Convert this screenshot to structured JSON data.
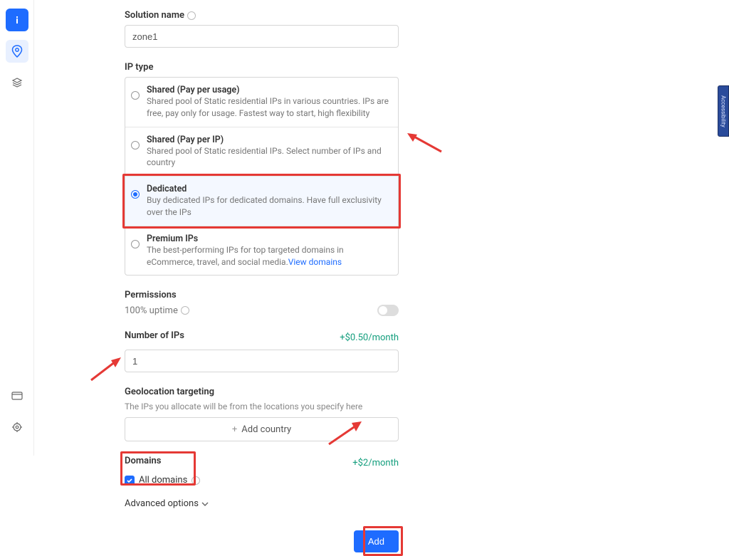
{
  "solution": {
    "label": "Solution name",
    "value": "zone1"
  },
  "ipType": {
    "label": "IP type",
    "options": [
      {
        "title": "Shared (Pay per usage)",
        "desc": "Shared pool of Static residential IPs in various countries. IPs are free, pay only for usage. Fastest way to start, high flexibility",
        "selected": false
      },
      {
        "title": "Shared (Pay per IP)",
        "desc": "Shared pool of Static residential IPs. Select number of IPs and country",
        "selected": false
      },
      {
        "title": "Dedicated",
        "desc": "Buy dedicated IPs for dedicated domains. Have full exclusivity over the IPs",
        "selected": true
      },
      {
        "title": "Premium IPs",
        "desc": "The best-performing IPs for top targeted domains in eCommerce, travel, and social media.",
        "link": "View domains",
        "selected": false
      }
    ]
  },
  "permissions": {
    "label": "Permissions",
    "value": "100% uptime"
  },
  "numIps": {
    "label": "Number of IPs",
    "price": "+$0.50/month",
    "value": "1"
  },
  "geo": {
    "label": "Geolocation targeting",
    "desc": "The IPs you allocate will be from the locations you specify here",
    "addCountry": "Add country"
  },
  "domains": {
    "label": "Domains",
    "price": "+$2/month",
    "checkboxLabel": "All domains"
  },
  "advanced": "Advanced options",
  "addButton": "Add",
  "accessibility": "Accessibility"
}
